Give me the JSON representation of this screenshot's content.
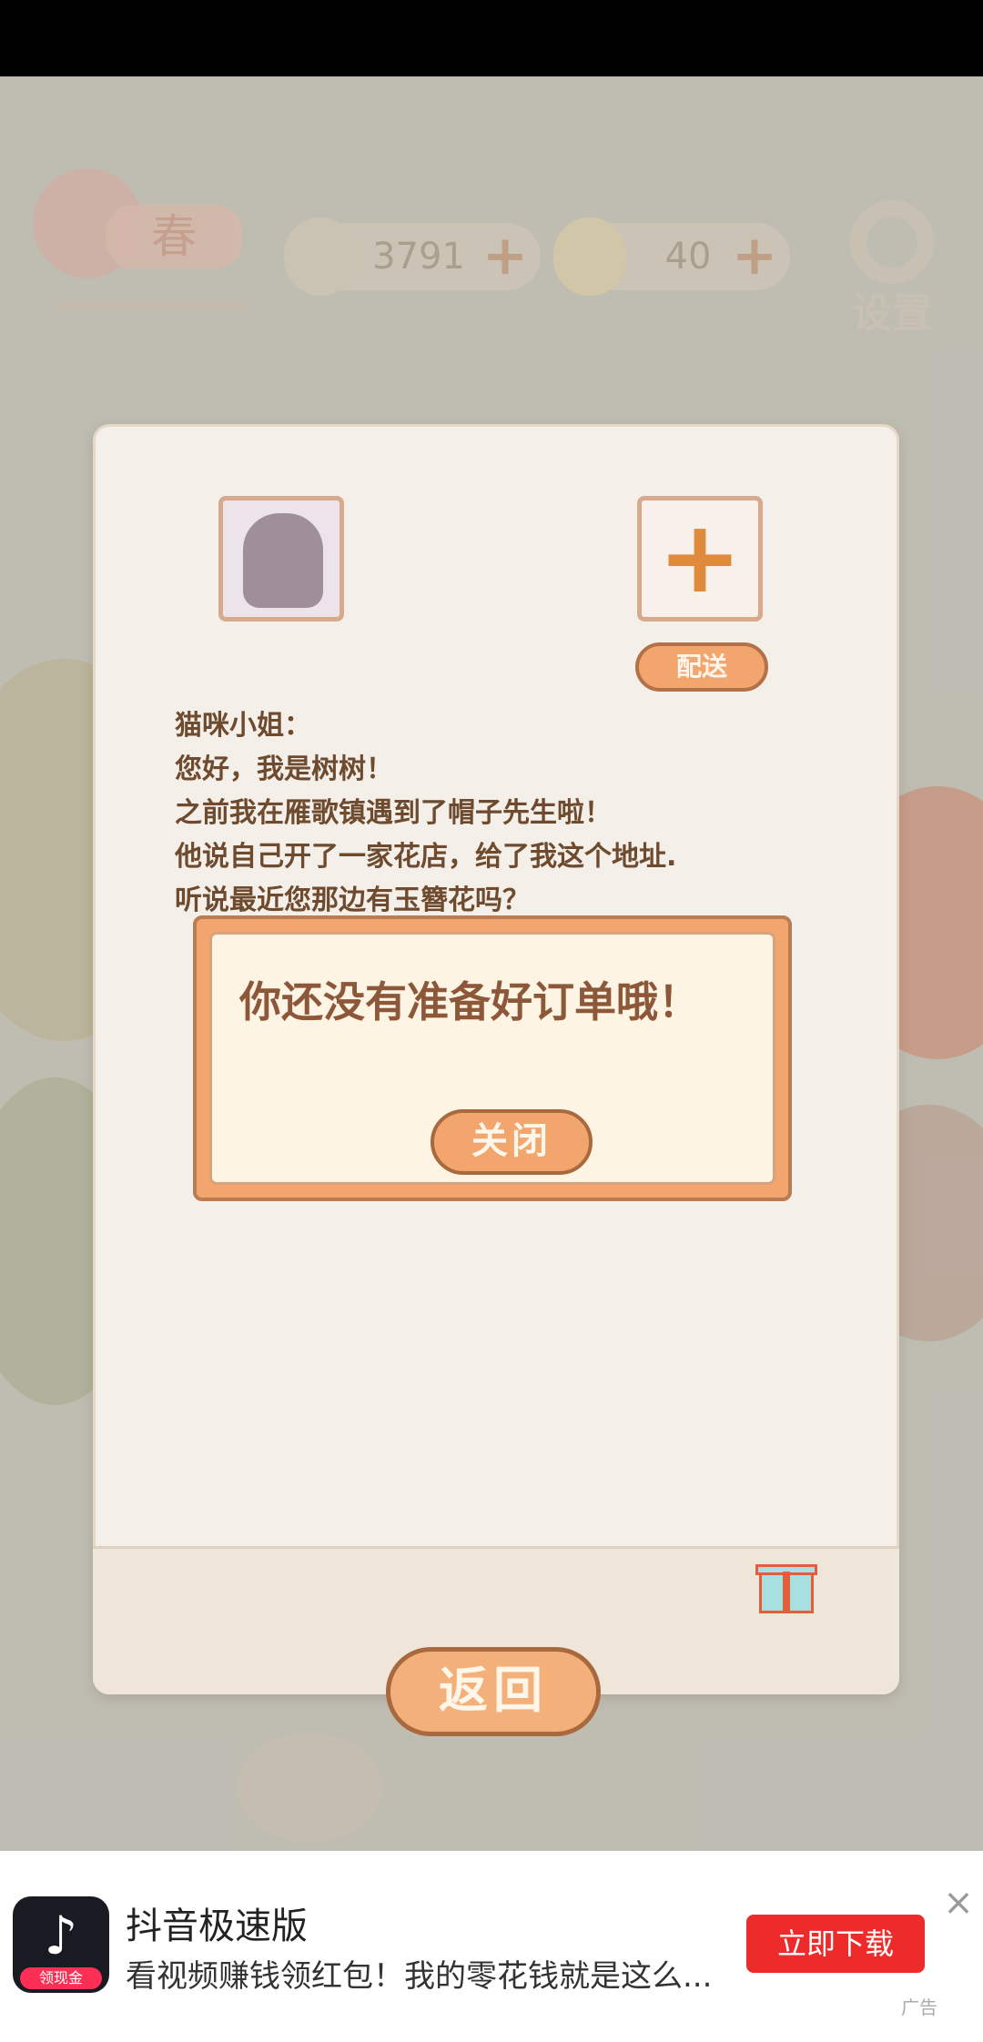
{
  "hud": {
    "season_label": "春",
    "fish_count": "3791",
    "cheese_count": "40",
    "settings_label": "设置"
  },
  "letter": {
    "deliver_label": "配送",
    "lines": [
      "猫咪小姐：",
      "您好，我是树树！",
      "之前我在雁歌镇遇到了帽子先生啦！",
      "他说自己开了一家花店，给了我这个地址.",
      "听说最近您那边有玉簪花吗？"
    ],
    "back_label": "返回"
  },
  "dialog": {
    "message": "你还没有准备好订单哦！",
    "close_label": "关闭"
  },
  "ad": {
    "app_name": "抖音极速版",
    "description": "看视频赚钱领红包！我的零花钱就是这么...",
    "cta_label": "立即下载",
    "badge": "领现金",
    "ad_label": "广告"
  }
}
